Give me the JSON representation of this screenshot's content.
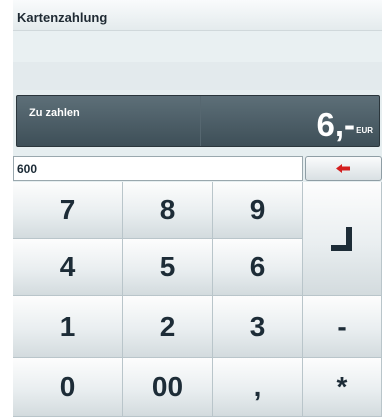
{
  "title": "Kartenzahlung",
  "amount": {
    "label": "Zu zahlen",
    "value": "6,-",
    "currency": "EUR"
  },
  "input": {
    "value": "600"
  },
  "colors": {
    "backspace_arrow": "#d41f1f",
    "amount_panel": "#4a5c66"
  },
  "keys": {
    "k7": "7",
    "k8": "8",
    "k9": "9",
    "k4": "4",
    "k5": "5",
    "k6": "6",
    "k1": "1",
    "k2": "2",
    "k3": "3",
    "k0": "0",
    "k00": "00",
    "comma": ",",
    "minus": "-",
    "multiply": "*"
  },
  "icons": {
    "backspace": "left-arrow-icon",
    "enter": "enter-return-icon"
  }
}
